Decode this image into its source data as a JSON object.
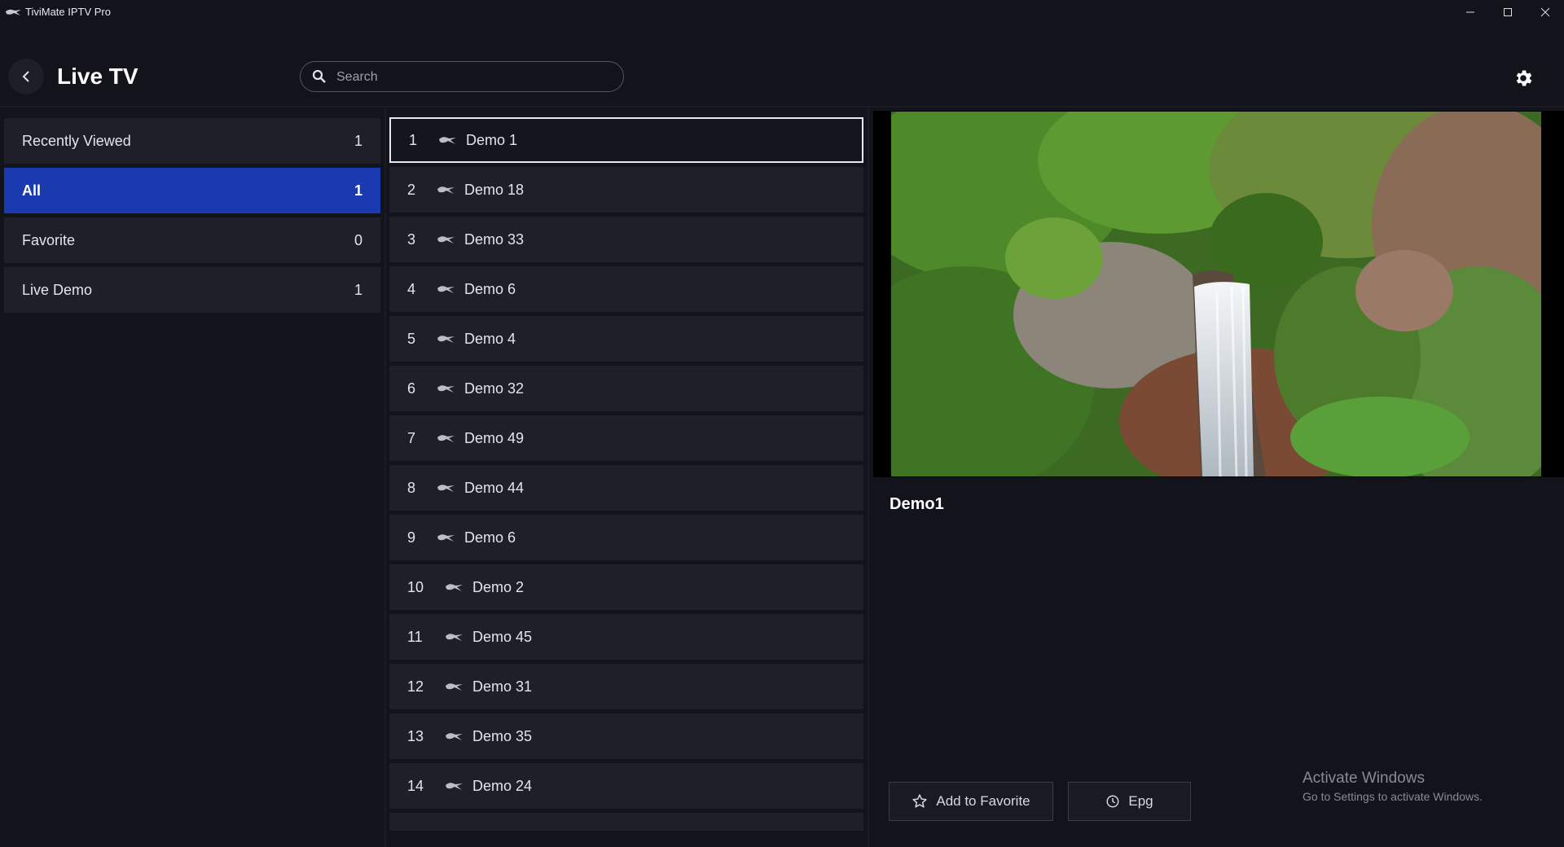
{
  "app": {
    "title": "TiviMate IPTV Pro"
  },
  "header": {
    "title": "Live TV",
    "search_placeholder": "Search"
  },
  "categories": [
    {
      "label": "Recently Viewed",
      "count": "1",
      "active": false
    },
    {
      "label": "All",
      "count": "1",
      "active": true
    },
    {
      "label": "Favorite",
      "count": "0",
      "active": false
    },
    {
      "label": "Live Demo",
      "count": "1",
      "active": false
    }
  ],
  "channels": [
    {
      "num": "1",
      "name": "Demo 1",
      "selected": true
    },
    {
      "num": "2",
      "name": "Demo 18"
    },
    {
      "num": "3",
      "name": "Demo 33"
    },
    {
      "num": "4",
      "name": "Demo 6"
    },
    {
      "num": "5",
      "name": "Demo 4"
    },
    {
      "num": "6",
      "name": "Demo 32"
    },
    {
      "num": "7",
      "name": "Demo 49"
    },
    {
      "num": "8",
      "name": "Demo 44"
    },
    {
      "num": "9",
      "name": "Demo 6"
    },
    {
      "num": "10",
      "name": "Demo 2"
    },
    {
      "num": "11",
      "name": "Demo 45"
    },
    {
      "num": "12",
      "name": "Demo 31"
    },
    {
      "num": "13",
      "name": "Demo 35"
    },
    {
      "num": "14",
      "name": "Demo 24"
    },
    {
      "num": "",
      "name": ""
    }
  ],
  "preview": {
    "title": "Demo1",
    "add_favorite_label": "Add to Favorite",
    "epg_label": "Epg"
  },
  "watermark": {
    "title": "Activate Windows",
    "subtitle": "Go to Settings to activate Windows."
  },
  "icons": {
    "back": "chevron-left-icon",
    "search": "search-icon",
    "settings": "gear-icon",
    "favorite": "star-icon",
    "epg": "clock-icon",
    "channel_logo": "channel-logo-icon"
  },
  "colors": {
    "background": "#13131c",
    "panel": "#1f1f29",
    "accent": "#1a3aaf"
  }
}
